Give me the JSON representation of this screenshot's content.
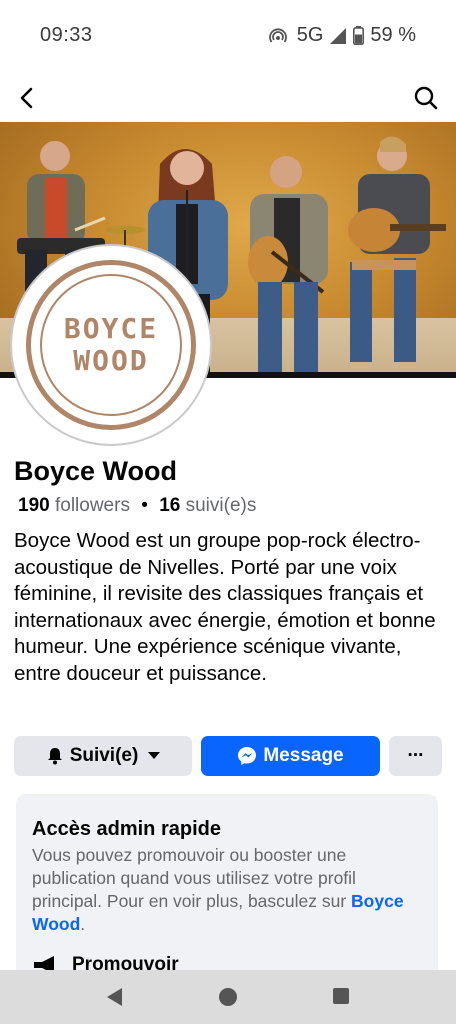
{
  "status_bar": {
    "time": "09:33",
    "network": "5G",
    "battery": "59 %"
  },
  "top_nav": {
    "back_icon": "chevron-left-icon",
    "search_icon": "search-icon"
  },
  "cover": {
    "description_colors": {
      "background": "#c88a30"
    }
  },
  "avatar": {
    "logo_line1": "BOYCE",
    "logo_line2": "WOOD",
    "logo_color": "#b08668"
  },
  "profile": {
    "name": "Boyce Wood",
    "followers_count": "190",
    "followers_label": "followers",
    "separator": "•",
    "following_count": "16",
    "following_label": "suivi(e)s",
    "bio": "Boyce Wood est un groupe pop-rock électro-acoustique de Nivelles. Porté par une voix féminine, il revisite des classiques français et internationaux avec énergie, émotion et bonne humeur. Une expérience scénique vivante, entre douceur et puissance."
  },
  "actions": {
    "follow_label": "Suivi(e)",
    "message_label": "Message",
    "more_label": "···",
    "accent_color": "#0866ff"
  },
  "admin_card": {
    "title": "Accès admin rapide",
    "text_before_link": "Vous pouvez promouvoir ou booster une publication quand vous utilisez votre profil principal. Pour en voir plus, basculez sur ",
    "link_text": "Boyce Wood",
    "text_after_link": ".",
    "promote_label": "Promouvoir"
  },
  "android_nav": {
    "back": "triangle-back-icon",
    "home": "circle-home-icon",
    "recents": "square-recents-icon"
  }
}
